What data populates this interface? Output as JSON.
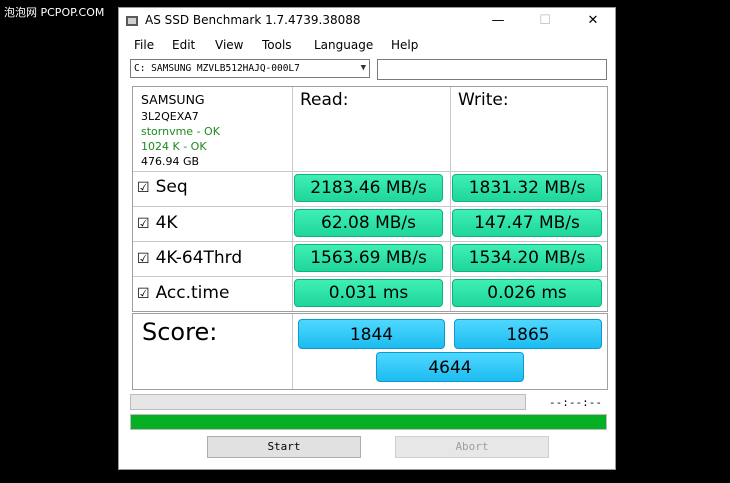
{
  "watermark": "泡泡网 PCPOP.COM",
  "window": {
    "title": "AS SSD Benchmark 1.7.4739.38088",
    "minimize": "—",
    "maximize": "☐",
    "close": "✕"
  },
  "menu": [
    "File",
    "Edit",
    "View",
    "Tools",
    "Language",
    "Help"
  ],
  "drive": {
    "selected": "C: SAMSUNG MZVLB512HAJQ-000L7",
    "text_value": ""
  },
  "info": {
    "vendor": "SAMSUNG",
    "firmware": "3L2QEXA7",
    "driver": "stornvme - OK",
    "alignment": "1024 K - OK",
    "capacity": "476.94 GB"
  },
  "headers": {
    "read": "Read:",
    "write": "Write:"
  },
  "rows": [
    {
      "label": "Seq",
      "checked": "☑",
      "read": "2183.46 MB/s",
      "write": "1831.32 MB/s"
    },
    {
      "label": "4K",
      "checked": "☑",
      "read": "62.08 MB/s",
      "write": "147.47 MB/s"
    },
    {
      "label": "4K-64Thrd",
      "checked": "☑",
      "read": "1563.69 MB/s",
      "write": "1534.20 MB/s"
    },
    {
      "label": "Acc.time",
      "checked": "☑",
      "read": "0.031 ms",
      "write": "0.026 ms"
    }
  ],
  "score": {
    "label": "Score:",
    "read": "1844",
    "write": "1865",
    "total": "4644"
  },
  "elapsed": "--:--:--",
  "progress_fraction": 1.0,
  "buttons": {
    "start": "Start",
    "abort": "Abort"
  },
  "colors": {
    "result_green": "#2ee6a8",
    "score_blue": "#29c7f7",
    "progress_green": "#06b025",
    "ok_green": "#1e8a1e"
  }
}
